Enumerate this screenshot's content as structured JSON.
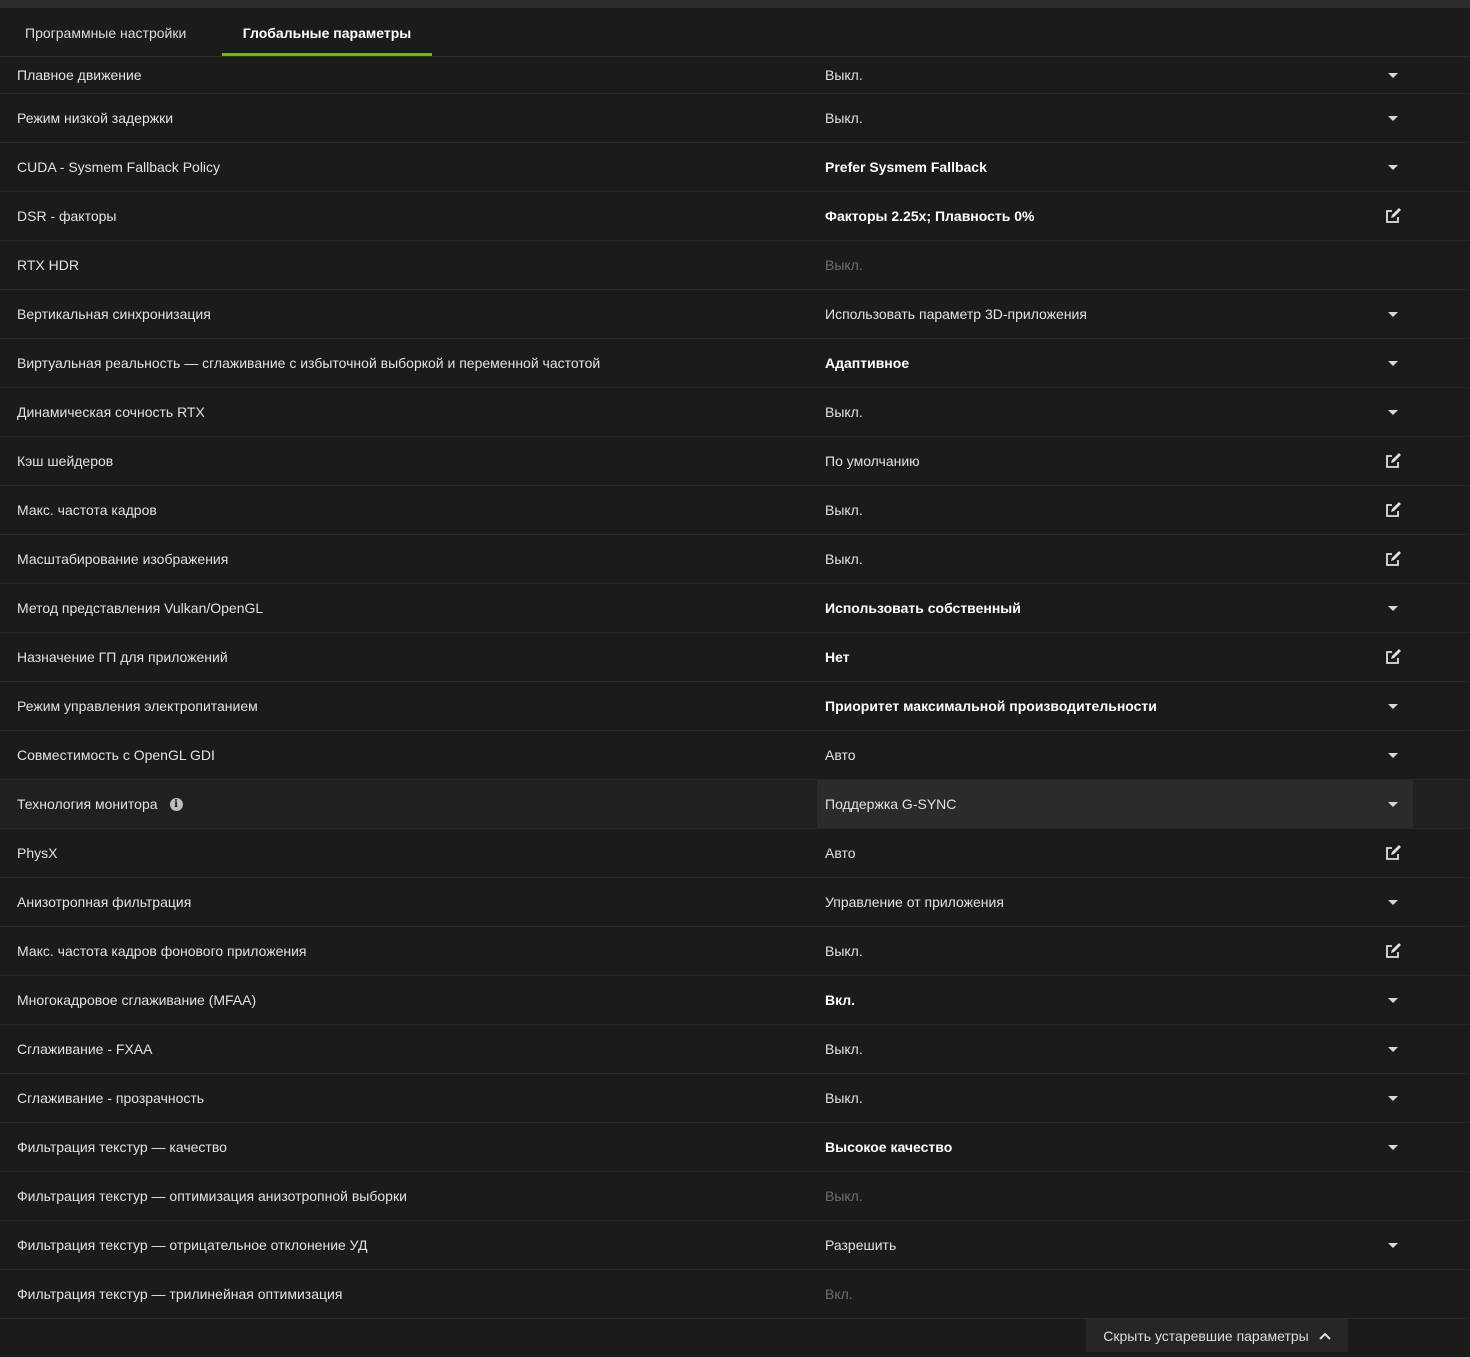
{
  "tabs": [
    {
      "label": "Программные настройки",
      "active": false
    },
    {
      "label": "Глобальные параметры",
      "active": true
    }
  ],
  "settings": [
    {
      "label": "Плавное движение",
      "value": "Выкл.",
      "style": "normal",
      "control": "dropdown"
    },
    {
      "label": "Режим низкой задержки",
      "value": "Выкл.",
      "style": "normal",
      "control": "dropdown"
    },
    {
      "label": "CUDA - Sysmem Fallback Policy",
      "value": "Prefer Sysmem Fallback",
      "style": "bold",
      "control": "dropdown"
    },
    {
      "label": "DSR - факторы",
      "value": "Факторы 2.25x; Плавность 0%",
      "style": "bold",
      "control": "edit"
    },
    {
      "label": "RTX HDR",
      "value": "Выкл.",
      "style": "disabled",
      "control": "none"
    },
    {
      "label": "Вертикальная синхронизация",
      "value": "Использовать параметр 3D-приложения",
      "style": "normal",
      "control": "dropdown"
    },
    {
      "label": "Виртуальная реальность — сглаживание с избыточной выборкой и переменной частотой",
      "value": "Адаптивное",
      "style": "bold",
      "control": "dropdown"
    },
    {
      "label": "Динамическая сочность RTX",
      "value": "Выкл.",
      "style": "normal",
      "control": "dropdown"
    },
    {
      "label": "Кэш шейдеров",
      "value": "По умолчанию",
      "style": "normal",
      "control": "edit"
    },
    {
      "label": "Макс. частота кадров",
      "value": "Выкл.",
      "style": "normal",
      "control": "edit"
    },
    {
      "label": "Масштабирование изображения",
      "value": "Выкл.",
      "style": "normal",
      "control": "edit"
    },
    {
      "label": "Метод представления Vulkan/OpenGL",
      "value": "Использовать собственный",
      "style": "bold",
      "control": "dropdown"
    },
    {
      "label": "Назначение ГП для приложений",
      "value": "Нет",
      "style": "bold",
      "control": "edit"
    },
    {
      "label": "Режим управления электропитанием",
      "value": "Приоритет максимальной производительности",
      "style": "bold",
      "control": "dropdown"
    },
    {
      "label": "Совместимость с OpenGL GDI",
      "value": "Авто",
      "style": "normal",
      "control": "dropdown"
    },
    {
      "label": "Технология монитора",
      "value": "Поддержка G-SYNC",
      "style": "normal",
      "control": "dropdown",
      "info": true,
      "hover": true
    },
    {
      "label": "PhysX",
      "value": "Авто",
      "style": "normal",
      "control": "edit"
    },
    {
      "label": "Анизотропная фильтрация",
      "value": "Управление от приложения",
      "style": "normal",
      "control": "dropdown"
    },
    {
      "label": "Макс. частота кадров фонового приложения",
      "value": "Выкл.",
      "style": "normal",
      "control": "edit"
    },
    {
      "label": "Многокадровое сглаживание (MFAA)",
      "value": "Вкл.",
      "style": "bold",
      "control": "dropdown"
    },
    {
      "label": "Сглаживание - FXAA",
      "value": "Выкл.",
      "style": "normal",
      "control": "dropdown"
    },
    {
      "label": "Сглаживание - прозрачность",
      "value": "Выкл.",
      "style": "normal",
      "control": "dropdown"
    },
    {
      "label": "Фильтрация текстур — качество",
      "value": "Высокое качество",
      "style": "bold",
      "control": "dropdown"
    },
    {
      "label": "Фильтрация текстур — оптимизация анизотропной выборки",
      "value": "Выкл.",
      "style": "disabled",
      "control": "none"
    },
    {
      "label": "Фильтрация текстур — отрицательное отклонение УД",
      "value": "Разрешить",
      "style": "normal",
      "control": "dropdown"
    },
    {
      "label": "Фильтрация текстур — трилинейная оптимизация",
      "value": "Вкл.",
      "style": "disabled",
      "control": "none"
    }
  ],
  "footer": {
    "hide_deprecated_label": "Скрыть устаревшие параметры",
    "icon": "chevron-up-icon"
  },
  "colors": {
    "background": "#1b1b1b",
    "accent": "#76b900",
    "disabled_text": "#6e6e6e"
  }
}
